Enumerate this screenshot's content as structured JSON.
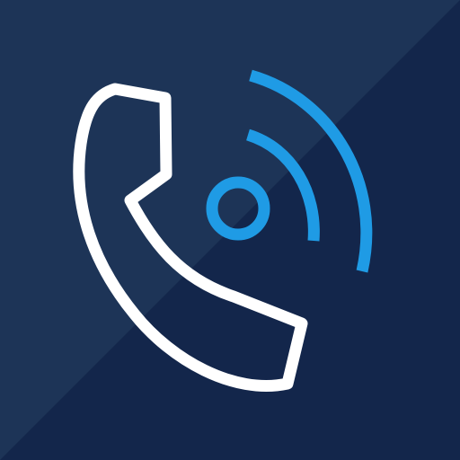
{
  "icon": {
    "name": "phone-call-icon",
    "colors": {
      "background_light": "#1d3457",
      "background_dark": "#13264b",
      "handset": "#ffffff",
      "signal": "#1f9be5"
    }
  }
}
